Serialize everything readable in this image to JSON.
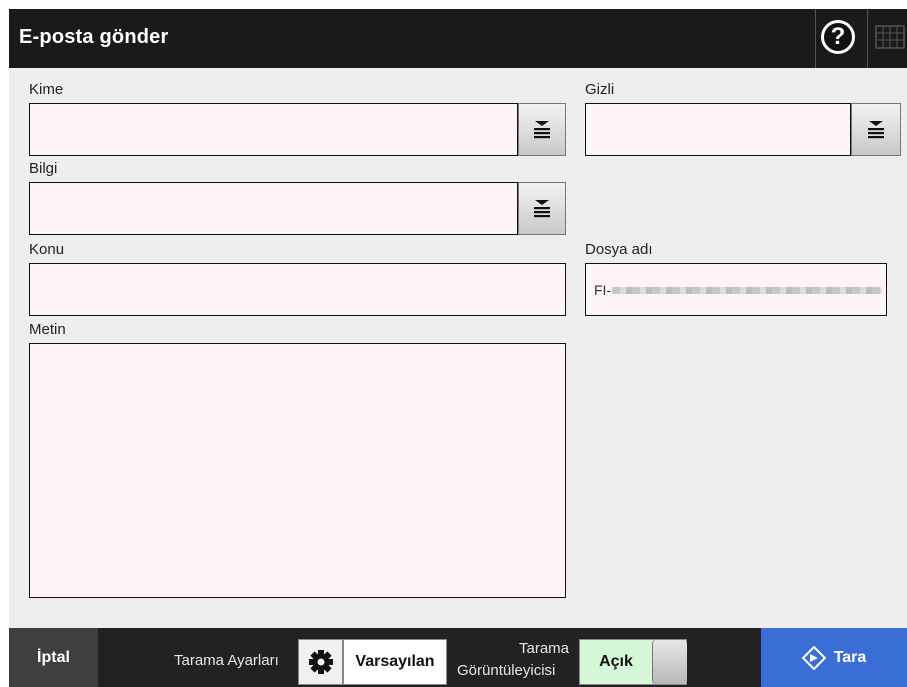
{
  "header": {
    "title": "E-posta gönder",
    "help_symbol": "?"
  },
  "fields": {
    "to_label": "Kime",
    "to_value": "",
    "bcc_label": "Gizli",
    "bcc_value": "",
    "cc_label": "Bilgi",
    "cc_value": "",
    "subject_label": "Konu",
    "subject_value": "",
    "filename_label": "Dosya adı",
    "filename_value": "FI-",
    "body_label": "Metin",
    "body_value": ""
  },
  "footer": {
    "cancel_label": "İptal",
    "scan_settings_label": "Tarama Ayarları",
    "default_label": "Varsayılan",
    "viewer_label_line1": "Tarama",
    "viewer_label_line2": "Görüntüleyicisi",
    "viewer_toggle_state": "Açık",
    "scan_label": "Tara"
  },
  "colors": {
    "header_bg": "#1a1a1a",
    "field_bg": "#fdf5f5",
    "toggle_on": "#d5f7d5",
    "scan_button": "#3a6ed6",
    "footer_bg": "#222222"
  },
  "icons": [
    "help-icon",
    "keyboard-icon",
    "address-list-icon",
    "gear-icon",
    "scan-diamond-icon"
  ]
}
